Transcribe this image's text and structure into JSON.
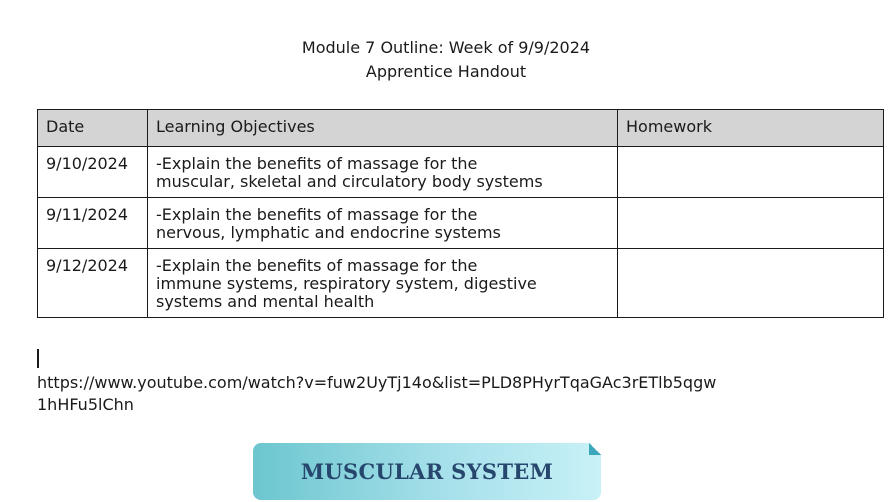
{
  "header": {
    "title": "Module 7 Outline: Week of 9/9/2024",
    "subtitle": "Apprentice Handout"
  },
  "table": {
    "columns": [
      "Date",
      "Learning Objectives",
      "Homework"
    ],
    "rows": [
      {
        "date": "9/10/2024",
        "objective_line1": "-Explain the benefits of massage for the",
        "objective_line2": "muscular, skeletal and circulatory body systems",
        "objective_line3": "",
        "homework": ""
      },
      {
        "date": "9/11/2024",
        "objective_line1": "-Explain the benefits of massage for the",
        "objective_line2": "nervous, lymphatic and endocrine systems",
        "objective_line3": "",
        "homework": ""
      },
      {
        "date": "9/12/2024",
        "objective_line1": "-Explain the benefits of massage for the",
        "objective_line2": "immune systems, respiratory system, digestive",
        "objective_line3": "systems and mental health",
        "homework": ""
      }
    ]
  },
  "link": {
    "line1": "https://www.youtube.com/watch?v=fuw2UyTj14o&list=PLD8PHyrTqaGAc3rETlb5qgw",
    "line2": "1hHFu5lChn"
  },
  "banner": {
    "label": "MUSCULAR SYSTEM"
  }
}
